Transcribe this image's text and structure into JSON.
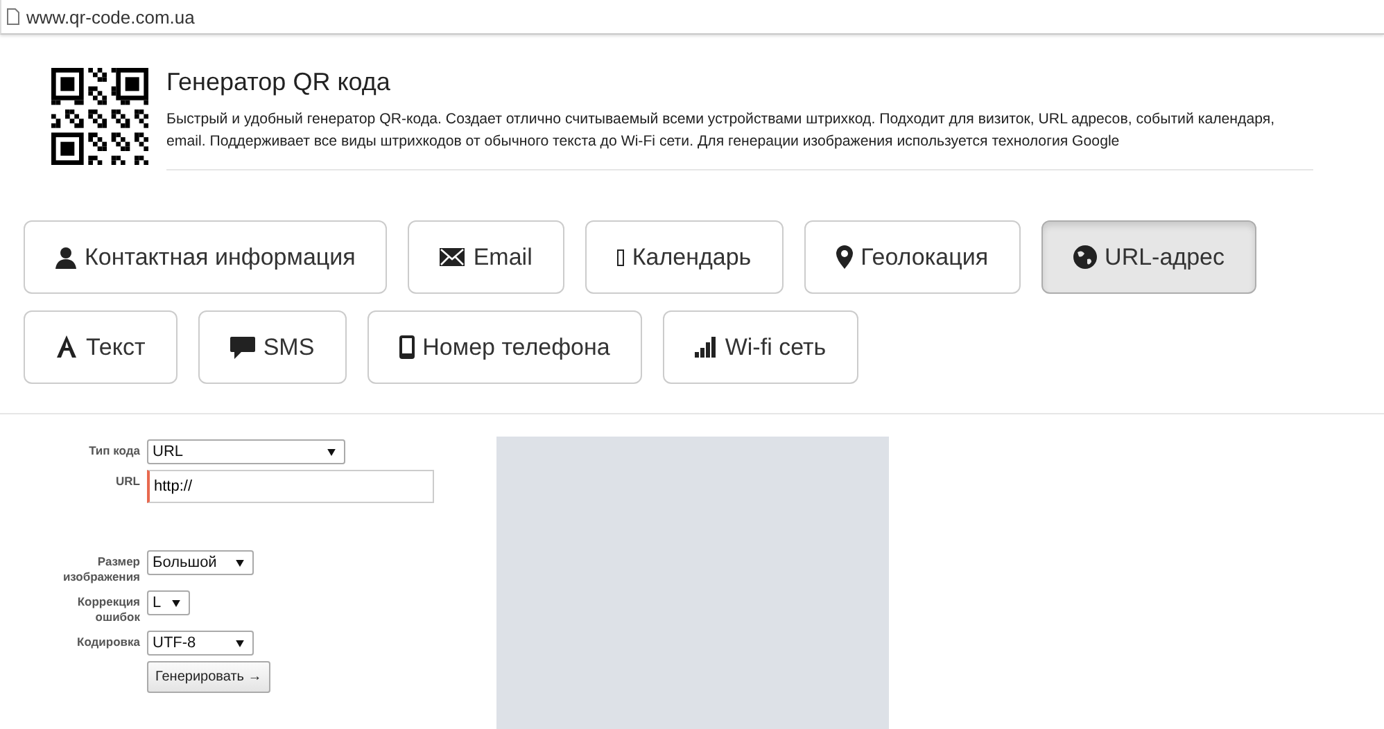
{
  "address_bar": {
    "url": "www.qr-code.com.ua"
  },
  "header": {
    "title": "Генератор QR кода",
    "description": "Быстрый и удобный генератор QR-кода. Создает отлично считываемый всеми устройствами штрихкод. Подходит для визиток, URL адресов, событий календаря, email. Поддерживает все виды штрихкодов от обычного текста до Wi-Fi сети. Для генерации изображения используется технология Google"
  },
  "type_buttons": [
    [
      {
        "kind": "person",
        "label": "Контактная информация",
        "selected": false
      },
      {
        "kind": "envelope",
        "label": "Email",
        "selected": false
      },
      {
        "kind": "missing",
        "label": "Календарь",
        "selected": false
      },
      {
        "kind": "pin",
        "label": "Геолокация",
        "selected": false
      },
      {
        "kind": "globe",
        "label": "URL-адрес",
        "selected": true
      }
    ],
    [
      {
        "kind": "letter",
        "label": "Текст",
        "selected": false
      },
      {
        "kind": "chat",
        "label": "SMS",
        "selected": false
      },
      {
        "kind": "phone",
        "label": "Номер телефона",
        "selected": false
      },
      {
        "kind": "signal",
        "label": "Wi-fi сеть",
        "selected": false
      }
    ]
  ],
  "form": {
    "fields": [
      {
        "kind": "select",
        "label": "Тип кода",
        "value": "URL"
      },
      {
        "kind": "input",
        "label": "URL",
        "value": "http://"
      },
      {
        "kind": "select",
        "label": "Размер изображения",
        "value": "Большой"
      },
      {
        "kind": "select",
        "label": "Коррекция ошибок",
        "value": "L"
      },
      {
        "kind": "select",
        "label": "Кодировка",
        "value": "UTF-8"
      }
    ],
    "submit": "Генерировать →"
  }
}
